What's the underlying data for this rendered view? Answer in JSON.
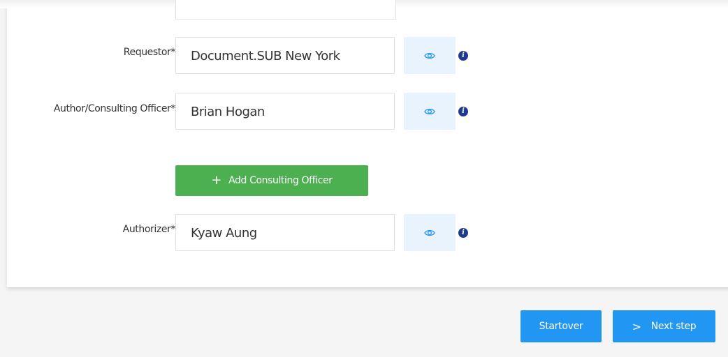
{
  "form": {
    "requestor": {
      "label": "Requestor*",
      "value": "Document.SUB New York"
    },
    "author": {
      "label": "Author/Consulting Officer*",
      "value": "Brian Hogan"
    },
    "add_officer_button": {
      "icon": "+",
      "label": "Add Consulting Officer"
    },
    "authorizer": {
      "label": "Authorizer*",
      "value": "Kyaw Aung"
    },
    "info_glyph": "i"
  },
  "footer": {
    "startover_label": "Startover",
    "next_icon": ">",
    "next_label": "Next step"
  },
  "colors": {
    "primary": "#2196f3",
    "success": "#4caf50",
    "eye_button_bg": "#e8f3fd",
    "info_icon": "#1e3a8a"
  }
}
